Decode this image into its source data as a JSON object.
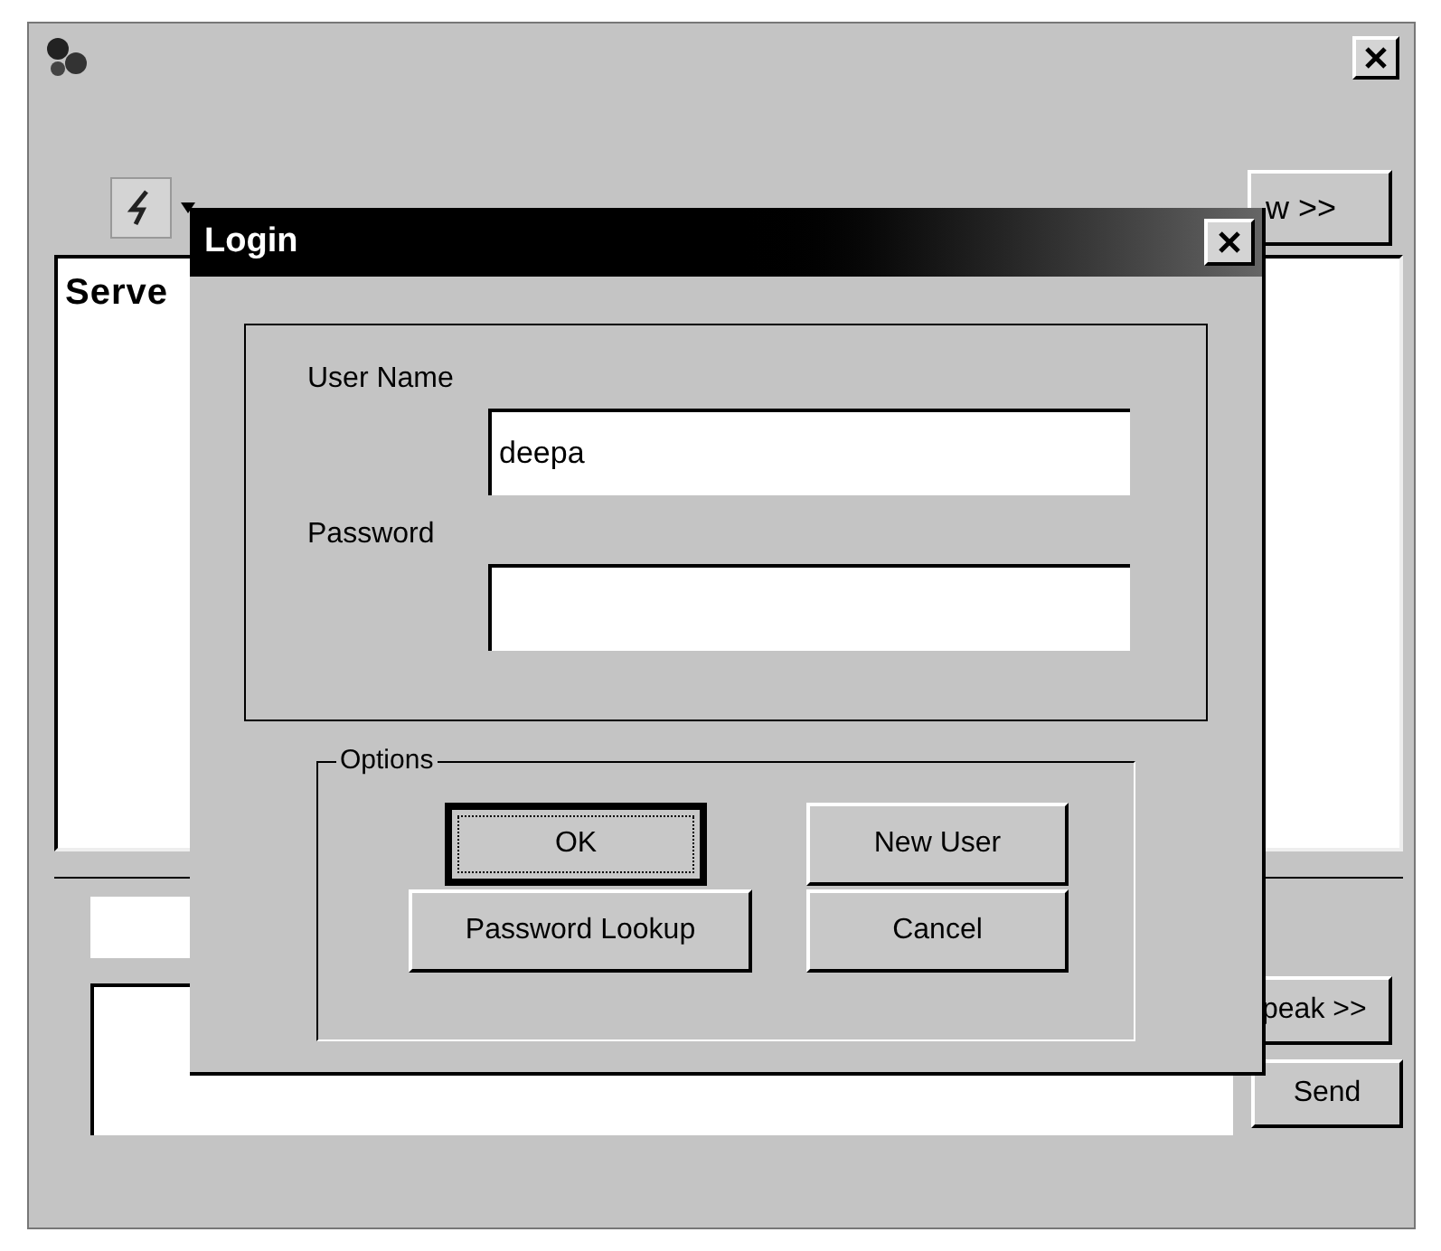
{
  "main_window": {
    "toolbar_button": "w >>",
    "log": "Serve",
    "speak_button": "peak >>",
    "send_button": "Send"
  },
  "login_dialog": {
    "title": "Login",
    "fields": [
      {
        "label": "User Name",
        "value": "deepa",
        "kind": "text"
      },
      {
        "label": "Password",
        "kind": "password"
      }
    ],
    "options": {
      "title": "Options",
      "buttons": [
        {
          "label": "OK",
          "default": true
        },
        {
          "label": "New User",
          "default": false
        },
        {
          "label": "Password Lookup",
          "default": false
        },
        {
          "label": "Cancel",
          "default": false
        }
      ]
    }
  }
}
